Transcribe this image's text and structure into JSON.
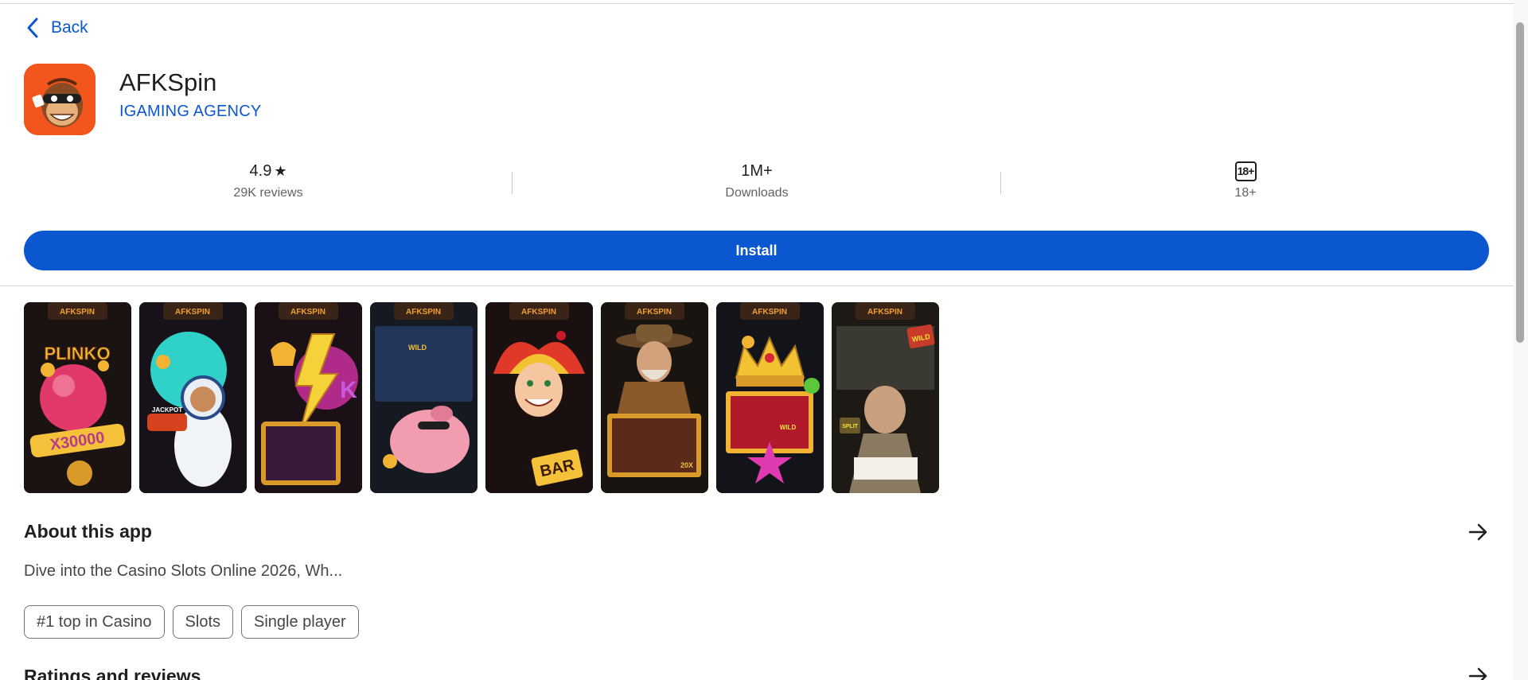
{
  "nav": {
    "back_label": "Back"
  },
  "app": {
    "title": "AFKSpin",
    "developer": "IGAMING AGENCY",
    "icon": "bandit-mascot-icon"
  },
  "stats": {
    "rating": {
      "value": "4.9",
      "icon": "star-icon",
      "label": "29K reviews"
    },
    "downloads": {
      "value": "1M+",
      "label": "Downloads"
    },
    "content_rating": {
      "badge": "18+",
      "label": "18+"
    }
  },
  "install_label": "Install",
  "screenshots": [
    {
      "brand": "AFKSPIN",
      "caption": "PLINKO",
      "sub": "X30000"
    },
    {
      "brand": "AFKSPIN",
      "caption": "JACKPOT",
      "sub": ""
    },
    {
      "brand": "AFKSPIN",
      "caption": "K",
      "sub": ""
    },
    {
      "brand": "AFKSPIN",
      "caption": "WILD",
      "sub": ""
    },
    {
      "brand": "AFKSPIN",
      "caption": "BAR",
      "sub": ""
    },
    {
      "brand": "AFKSPIN",
      "caption": "20X",
      "sub": ""
    },
    {
      "brand": "AFKSPIN",
      "caption": "WILD",
      "sub": ""
    },
    {
      "brand": "AFKSPIN",
      "caption": "SPLIT",
      "sub": "WILD"
    }
  ],
  "about": {
    "title": "About this app",
    "description": "Dive into the Casino Slots Online 2026, Wh...",
    "tags": [
      "#1 top in Casino",
      "Slots",
      "Single player"
    ]
  },
  "ratings": {
    "title": "Ratings and reviews"
  },
  "colors": {
    "accent": "#0b57d0",
    "icon_bg": "#f2561d"
  }
}
